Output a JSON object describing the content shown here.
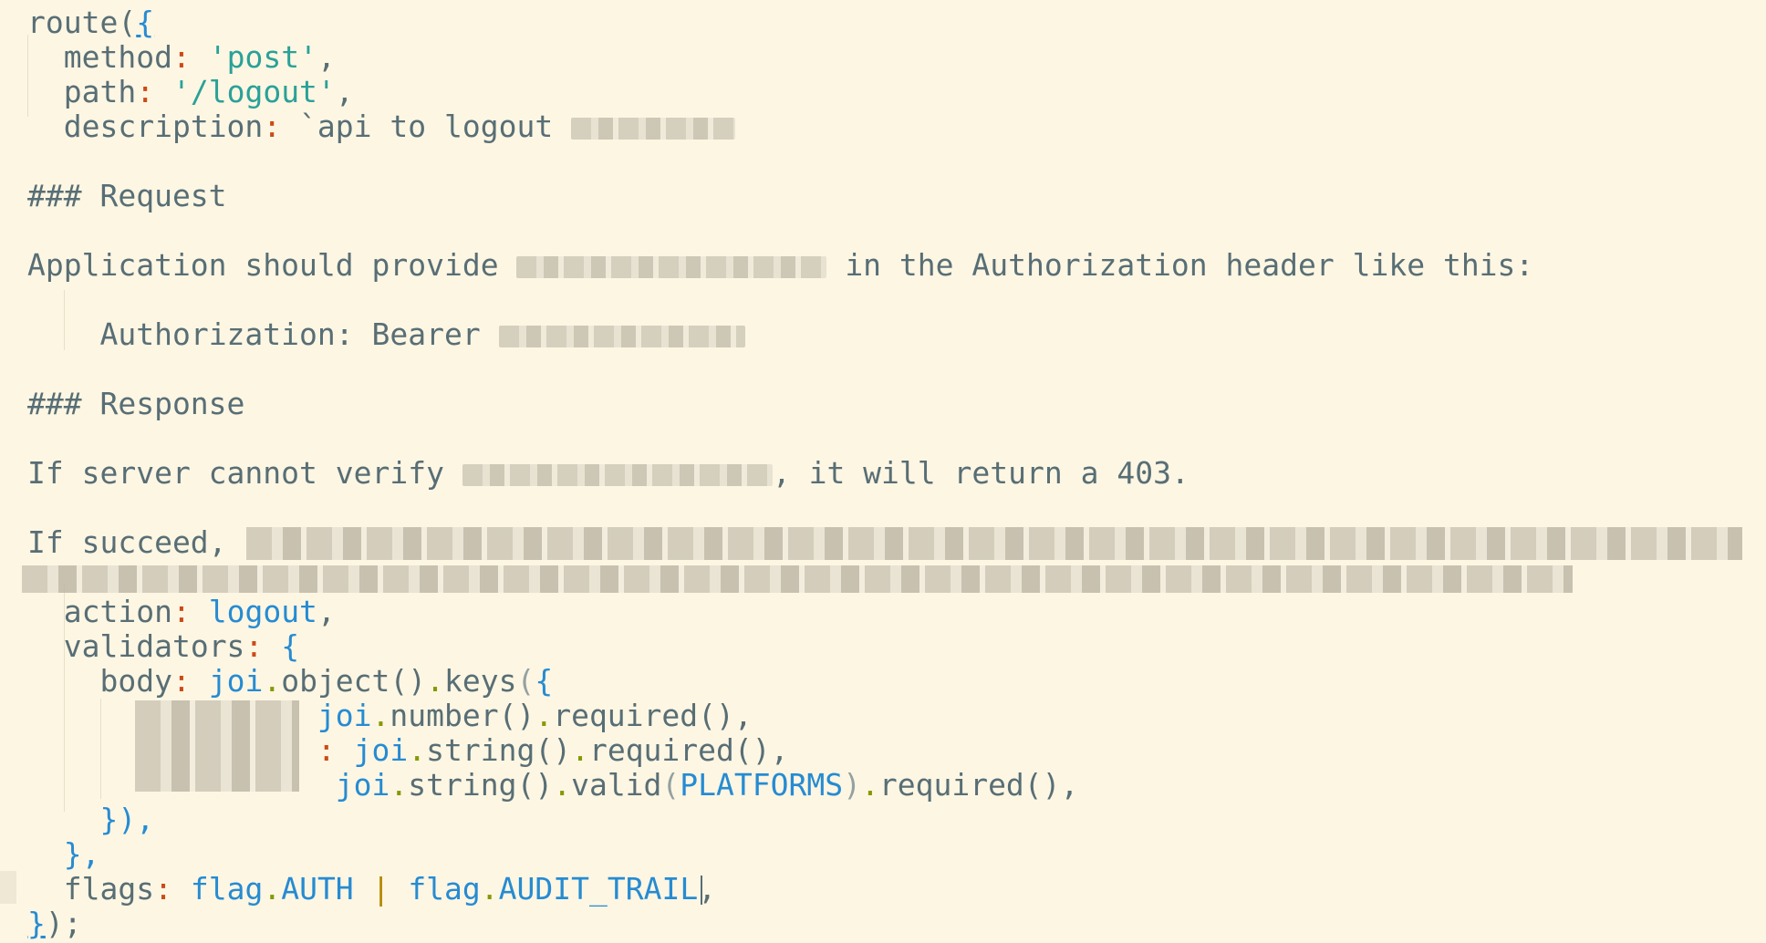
{
  "editor": {
    "lines": {
      "l1": {
        "kw": "route(",
        "brace": "{"
      },
      "l2": {
        "key": "method",
        "val": "'post'",
        "end": ","
      },
      "l3": {
        "key": "path",
        "val": "'/logout'",
        "end": ","
      },
      "l4": {
        "key": "description",
        "val": "`api to logout"
      },
      "l6": "### Request",
      "l8a": "Application should provide",
      "l8b": "in the Authorization header like this:",
      "l10": "Authorization: Bearer",
      "l12": "### Response",
      "l14a": "If server cannot verify",
      "l14b": ", it will return a 403.",
      "l16": "If succeed,",
      "l18": {
        "key": "action",
        "val": "logout",
        "end": ","
      },
      "l19": {
        "key": "validators",
        "brace": "{"
      },
      "l20": {
        "key": "body",
        "obj": "joi",
        "call1": "object()",
        "call2": "keys",
        "paren": "(",
        "brace": "{"
      },
      "l21": {
        "obj": "joi",
        "call1": "number()",
        "call2": "required()",
        "end": ","
      },
      "l22": {
        "colon": ":",
        "obj": "joi",
        "call1": "string()",
        "call2": "required()",
        "end": ","
      },
      "l23": {
        "obj": "joi",
        "call1": "string()",
        "call2": "valid",
        "arg": "PLATFORMS",
        "call3": "required()",
        "end": ","
      },
      "l24": "}),",
      "l25": "},",
      "l26": {
        "key": "flags",
        "obj1": "flag",
        "c1": "AUTH",
        "pipe": "|",
        "obj2": "flag",
        "c2": "AUDIT_TRAIL",
        "end": ","
      },
      "l27": {
        "brace": "}",
        "rest": ");"
      }
    }
  }
}
